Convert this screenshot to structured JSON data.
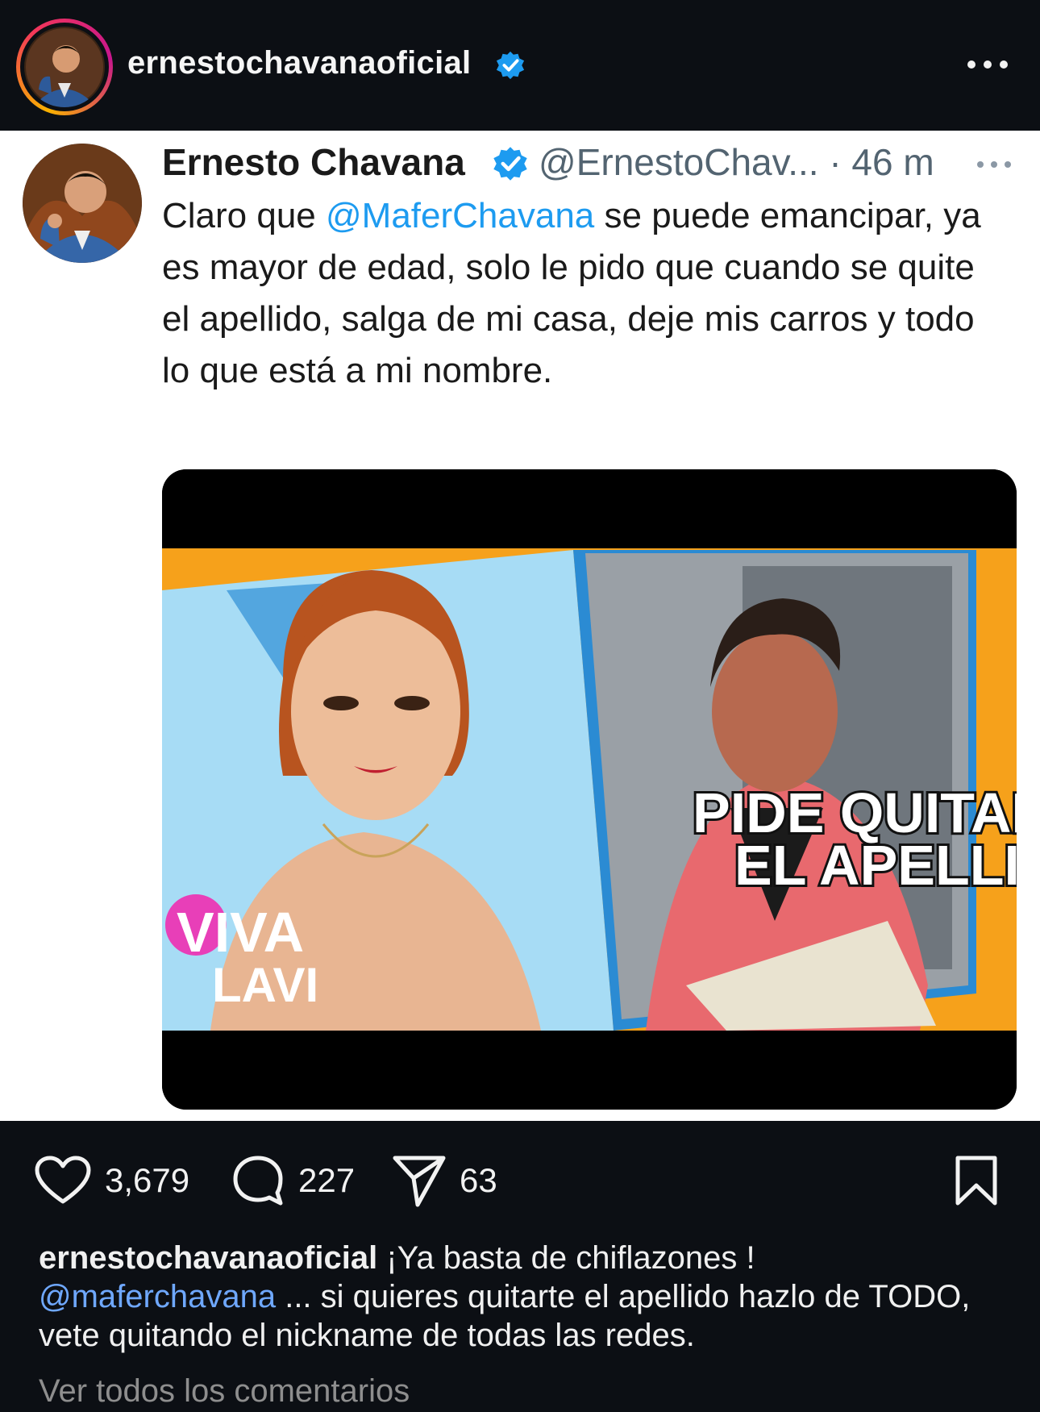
{
  "header": {
    "username": "ernestochavanaoficial",
    "icons": {
      "verified": "verified-badge-icon",
      "more": "more-dots-icon"
    }
  },
  "tweet": {
    "display_name": "Ernesto Chavana",
    "handle_time": "@ErnestoChav... · 46 m",
    "text": {
      "before_mention": "Claro que ",
      "mention": "@MaferChavana",
      "after_mention": " se puede emancipar, ya es mayor de edad, solo le pido que cuando se quite el apellido, salga de mi casa, deje mis carros y todo lo que está a mi nombre."
    },
    "media": {
      "headline_line1": "PIDE QUITARSE",
      "headline_line2": "EL APELLIDO",
      "logo_line1": "VIVA",
      "logo_line2": "LAVI"
    }
  },
  "actions": {
    "likes": "3,679",
    "comments": "227",
    "shares": "63",
    "icons": {
      "like": "heart-icon",
      "comment": "comment-bubble-icon",
      "share": "send-icon",
      "save": "bookmark-icon"
    }
  },
  "caption": {
    "username": "ernestochavanaoficial",
    "text_part1": " ¡Ya basta de chiflazones !",
    "mention": "@maferchavana",
    "text_part2": " ... si quieres quitarte el apellido hazlo de TODO, vete quitando el nickname de todas las redes."
  },
  "view_all_comments": "Ver todos los comentarios",
  "colors": {
    "background": "#0c0f14",
    "tweet_background": "#ffffff",
    "link_blue": "#1d9bf0",
    "verified_blue": "#1d9bf0",
    "thumbnail_orange": "#f6a11b",
    "thumbnail_blue": "#2f8fd6"
  }
}
